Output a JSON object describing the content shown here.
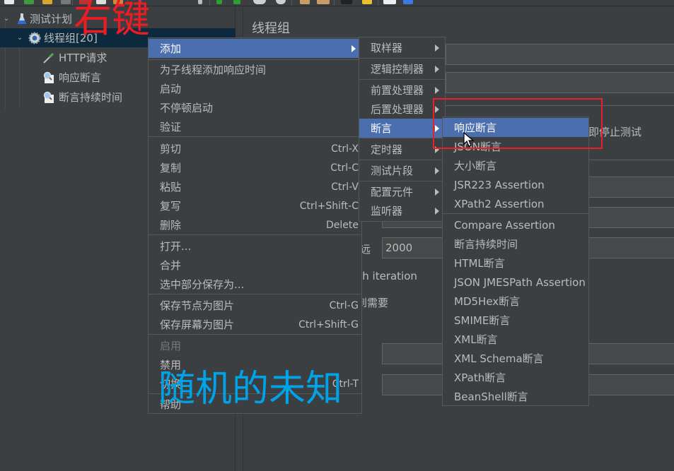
{
  "toolbar": {
    "icons": [
      "new-icon",
      "templates-icon",
      "open-icon",
      "save-icon",
      "cut-icon",
      "copy-icon",
      "paste-icon",
      "expand-icon",
      "collapse-icon",
      "toggle-icon",
      "start-icon",
      "start-no-pause-icon",
      "stop-icon",
      "shutdown-icon",
      "clear-icon",
      "clear-all-icon",
      "search-icon",
      "reset-search-icon",
      "function-helper-icon",
      "help-icon"
    ]
  },
  "tree": {
    "items": [
      {
        "label": "测试计划",
        "icon": "test-plan-flask-icon",
        "level": 0,
        "expanded": true
      },
      {
        "label": "线程组[20]",
        "icon": "thread-group-gear-icon",
        "level": 1,
        "expanded": true,
        "selected": true
      },
      {
        "label": "HTTP请求",
        "icon": "http-sampler-pipette-icon",
        "level": 2
      },
      {
        "label": "响应断言",
        "icon": "assertion-magnifier-icon",
        "level": 2
      },
      {
        "label": "断言持续时间",
        "icon": "assertion-magnifier-icon",
        "level": 2
      }
    ]
  },
  "panel": {
    "title": "线程组",
    "visible_texts": {
      "stop_test_now": "即停止测试",
      "forever_fragment": "远",
      "duration_value": "2000",
      "iteration_fragment": "ch iteration",
      "needed_fragment": "到需要"
    }
  },
  "context_menu": {
    "items": [
      {
        "label": "添加",
        "submenu": true,
        "active": true
      },
      {
        "label": "为子线程添加响应时间"
      },
      {
        "label": "启动"
      },
      {
        "label": "不停顿启动"
      },
      {
        "label": "验证"
      },
      {
        "label": "剪切",
        "shortcut": "Ctrl-X"
      },
      {
        "label": "复制",
        "shortcut": "Ctrl-C"
      },
      {
        "label": "粘贴",
        "shortcut": "Ctrl-V"
      },
      {
        "label": "复写",
        "shortcut": "Ctrl+Shift-C"
      },
      {
        "label": "删除",
        "shortcut": "Delete"
      },
      {
        "label": "打开..."
      },
      {
        "label": "合并"
      },
      {
        "label": "选中部分保存为..."
      },
      {
        "label": "保存节点为图片",
        "shortcut": "Ctrl-G"
      },
      {
        "label": "保存屏幕为图片",
        "shortcut": "Ctrl+Shift-G"
      },
      {
        "label": "启用",
        "disabled": true
      },
      {
        "label": "禁用"
      },
      {
        "label": "切换",
        "shortcut": "Ctrl-T"
      },
      {
        "label": "帮助"
      }
    ]
  },
  "add_submenu": {
    "items": [
      {
        "label": "取样器"
      },
      {
        "label": "逻辑控制器"
      },
      {
        "label": "前置处理器"
      },
      {
        "label": "后置处理器"
      },
      {
        "label": "断言",
        "active": true
      },
      {
        "label": "定时器"
      },
      {
        "label": "测试片段"
      },
      {
        "label": "配置元件"
      },
      {
        "label": "监听器"
      }
    ]
  },
  "assertion_submenu": {
    "items": [
      {
        "label": "响应断言",
        "active": true
      },
      {
        "label": "JSON断言"
      },
      {
        "label": "大小断言"
      },
      {
        "label": "JSR223 Assertion"
      },
      {
        "label": "XPath2 Assertion"
      },
      {
        "label": "Compare Assertion"
      },
      {
        "label": "断言持续时间"
      },
      {
        "label": "HTML断言"
      },
      {
        "label": "JSON JMESPath Assertion"
      },
      {
        "label": "MD5Hex断言"
      },
      {
        "label": "SMIME断言"
      },
      {
        "label": "XML断言"
      },
      {
        "label": "XML Schema断言"
      },
      {
        "label": "XPath断言"
      },
      {
        "label": "BeanShell断言"
      }
    ]
  },
  "annotations": {
    "right_click_label": "右键",
    "watermark": "随机的未知",
    "highlight_color": "#e8202a",
    "right_click_color": "#ec1c24",
    "watermark_color": "#00a2e8"
  },
  "colors": {
    "background": "#3c3f41",
    "selection": "#4b6eaf",
    "tree_selection": "#0d293e",
    "text": "#bbbbbb"
  }
}
